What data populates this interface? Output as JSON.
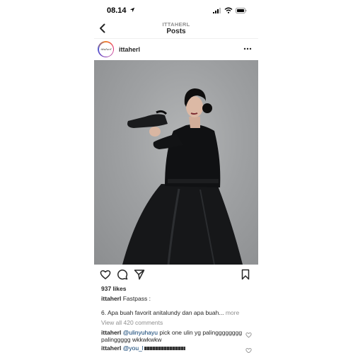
{
  "status_bar": {
    "time": "08.14",
    "icons": [
      "location-arrow-icon",
      "signal-icon",
      "wifi-icon",
      "battery-icon"
    ]
  },
  "nav": {
    "account": "ITTAHERL",
    "title": "Posts",
    "back_icon": "chevron-left-icon"
  },
  "post": {
    "username": "ittaherl",
    "avatar_text": "ittaherl",
    "more_icon": "ellipsis-icon",
    "photo_description": "",
    "likes": "937 likes",
    "caption_user": "ittaherl",
    "caption_text": "Fastpass :",
    "caption_line2": "6. Apa buah favorit anitalundy dan apa buah...",
    "more_label": "more",
    "view_all": "View all 420 comments",
    "comments": [
      {
        "user": "ittaherl",
        "mention": "@ulinyuhayu",
        "text": "pick one ulin yg palingggggggg palinggggg wkkwkwkw"
      },
      {
        "user": "ittaherl",
        "mention": "@you_l",
        "text": ""
      }
    ]
  },
  "colors": {
    "text": "#262626",
    "muted": "#8e8e8e",
    "mention": "#00376b",
    "divider": "#efefef"
  }
}
